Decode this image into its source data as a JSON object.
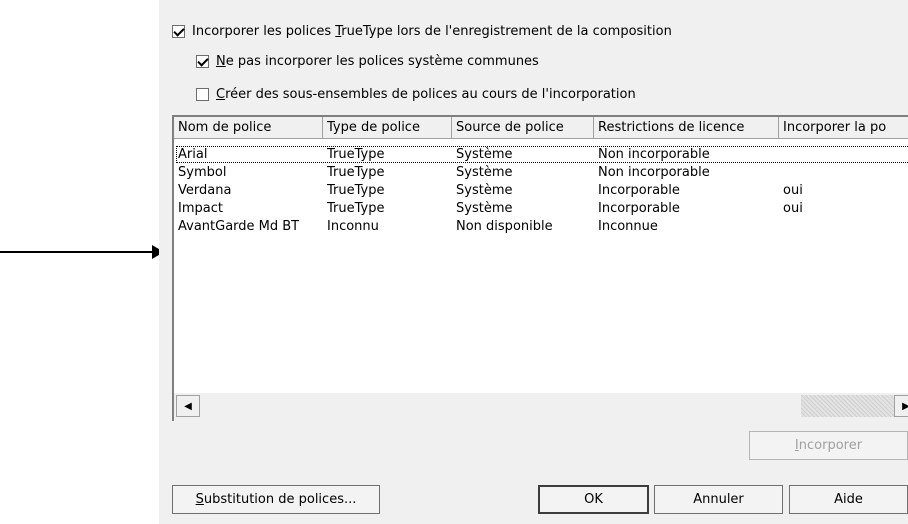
{
  "options": {
    "embed_truetype": {
      "before": "Incorporer les polices ",
      "mnemonic": "T",
      "after": "rueType lors de l'enregistrement de la composition",
      "checked": true
    },
    "no_common_fonts": {
      "mnemonic": "N",
      "after": "e pas incorporer les polices système communes",
      "checked": true
    },
    "create_subsets": {
      "mnemonic": "C",
      "after": "réer des sous-ensembles de polices au cours de l'incorporation",
      "checked": false
    }
  },
  "table": {
    "columns": [
      "Nom de police",
      "Type de police",
      "Source de police",
      "Restrictions de licence",
      "Incorporer la po"
    ],
    "rows": [
      [
        "Arial",
        "TrueType",
        "Système",
        "Non incorporable",
        ""
      ],
      [
        "Symbol",
        "TrueType",
        "Système",
        "Non incorporable",
        ""
      ],
      [
        "Verdana",
        "TrueType",
        "Système",
        "Incorporable",
        "oui"
      ],
      [
        "Impact",
        "TrueType",
        "Système",
        "Incorporable",
        "oui"
      ],
      [
        "AvantGarde Md BT",
        "Inconnu",
        "Non disponible",
        "Inconnue",
        ""
      ]
    ]
  },
  "scroll_icons": {
    "left": "left-arrow-icon",
    "right": "right-arrow-icon"
  },
  "buttons": {
    "embed": {
      "mnemonic": "I",
      "after": "ncorporer",
      "disabled": true
    },
    "substitution": {
      "mnemonic": "S",
      "after": "ubstitution de polices..."
    },
    "ok": "OK",
    "cancel": "Annuler",
    "help": "Aide"
  }
}
